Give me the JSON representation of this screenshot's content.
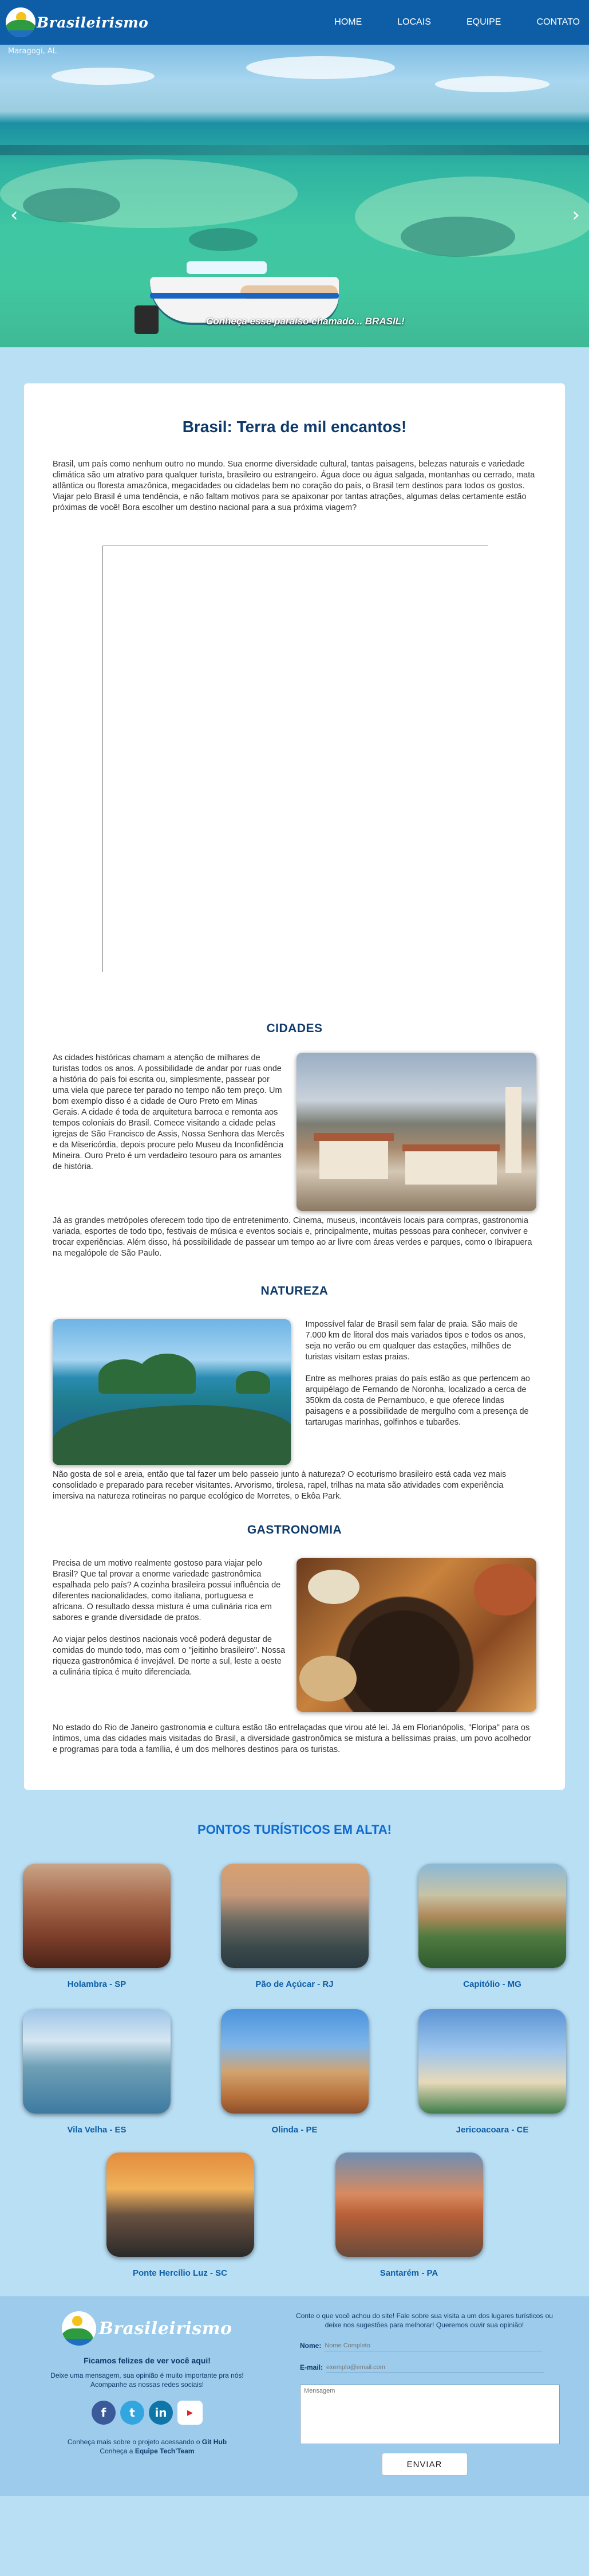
{
  "nav": {
    "brand": "Brasileirismo",
    "links": [
      "HOME",
      "LOCAIS",
      "EQUIPE",
      "CONTATO"
    ]
  },
  "hero": {
    "location": "Maragogi, AL",
    "caption": "Conheça esse paraíso chamado... BRASIL!",
    "prev": "‹",
    "next": "›"
  },
  "main": {
    "title": "Brasil: Terra de mil encantos!",
    "intro": "Brasil, um país como nenhum outro no mundo. Sua enorme diversidade cultural, tantas paisagens, belezas naturais e variedade climática são um atrativo para qualquer turista, brasileiro ou estrangeiro. Água doce ou água salgada, montanhas ou cerrado, mata atlântica ou floresta amazônica, megacidades ou cidadelas bem no coração do país, o Brasil tem destinos para todos os gostos. Viajar pelo Brasil é uma tendência, e não faltam motivos para se apaixonar por tantas atrações, algumas delas certamente estão próximas de você! Bora escolher um destino nacional para a sua próxima viagem?"
  },
  "cidades": {
    "title": "CIDADES",
    "p1": "As cidades históricas chamam a atenção de milhares de turistas todos os anos. A possibilidade de andar por ruas onde a história do país foi escrita ou, simplesmente, passear por uma viela que parece ter parado no tempo não tem preço. Um bom exemplo disso é a cidade de Ouro Preto em Minas Gerais. A cidade é toda de arquitetura barroca e remonta aos tempos coloniais do Brasil. Comece visitando a cidade pelas igrejas de São Francisco de Assis, Nossa Senhora das Mercês e da Misericórdia, depois procure pelo Museu da Inconfidência Mineira. Ouro Preto é um verdadeiro tesouro para os amantes de história.",
    "p2": "Já as grandes metrópoles oferecem todo tipo de entretenimento. Cinema, museus, incontáveis locais para compras, gastronomia variada, esportes de todo tipo, festivais de música e eventos sociais e, principalmente, muitas pessoas para conhecer, conviver e trocar experiências. Além disso, há possibilidade de passear um tempo ao ar livre com áreas verdes e parques, como o Ibirapuera na megalópole de São Paulo."
  },
  "natureza": {
    "title": "NATUREZA",
    "p1": "Impossível falar de Brasil sem falar de praia. São mais de 7.000 km de litoral dos mais variados tipos e todos os anos, seja no verão ou em qualquer das estações, milhões de turistas visitam estas praias.",
    "p2": "Entre as melhores praias do país estão as que pertencem ao arquipélago de Fernando de Noronha, localizado a cerca de 350km da costa de Pernambuco, e que oferece lindas paisagens e a possibilidade de mergulho com a presença de tartarugas marinhas, golfinhos e tubarões.",
    "p3": "Não gosta de sol e areia, então que tal fazer um belo passeio junto à natureza? O ecoturismo brasileiro está cada vez mais consolidado e preparado para receber visitantes. Arvorismo, tirolesa, rapel, trilhas na mata são atividades com experiência imersiva na natureza rotineiras no parque ecológico de Morretes, o Ekôa Park."
  },
  "gastronomia": {
    "title": "GASTRONOMIA",
    "p1": "Precisa de um motivo realmente gostoso para viajar pelo Brasil? Que tal provar a enorme variedade gastronômica espalhada pelo país? A cozinha brasileira possui influência de diferentes nacionalidades, como italiana, portuguesa e africana. O resultado dessa mistura é uma culinária rica em sabores e grande diversidade de pratos.",
    "p2": "Ao viajar pelos destinos nacionais você poderá degustar de comidas do mundo todo, mas com o \"jeitinho brasileiro\". Nossa riqueza gastronômica é invejável. De norte a sul, leste a oeste a culinária típica é muito diferenciada.",
    "p3": "No estado do Rio de Janeiro gastronomia e cultura estão tão entrelaçadas que virou até lei. Já em Florianópolis, \"Floripa\" para os íntimos, uma das cidades mais visitadas do Brasil, a diversidade gastronômica se mistura a belíssimas praias, um povo acolhedor e programas para toda a família, é um dos melhores destinos para os turistas."
  },
  "spots": {
    "title": "PONTOS TURÍSTICOS EM ALTA!",
    "items": [
      "Holambra - SP",
      "Pão de Açúcar - RJ",
      "Capitólio - MG",
      "Vila Velha - ES",
      "Olinda - PE",
      "Jericoacoara - CE",
      "Ponte Hercílio Luz - SC",
      "Santarém - PA"
    ]
  },
  "footer": {
    "brand": "Brasileirismo",
    "thanks": "Ficamos felizes de ver você aqui!",
    "leave_msg": "Deixe uma mensagem, sua opinião é muito importante pra nós!",
    "follow": "Acompanhe as nossas redes sociais!",
    "github_prefix": "Conheça mais sobre o projeto acessando o ",
    "github_link": "Git Hub",
    "team_prefix": "Conheça a ",
    "team_link": "Equipe Tech'Team",
    "prompt": "Conte o que você achou do site! Fale sobre sua visita a um dos lugares turísticos ou deixe nos sugestões para melhorar! Queremos ouvir sua opinião!",
    "name_label": "Nome:",
    "name_placeholder": "Nome Completo",
    "email_label": "E-mail:",
    "email_placeholder": "exemplo@email.com",
    "msg_placeholder": "Mensagem",
    "send": "ENVIAR"
  },
  "colors": {
    "navbar": "#0d5ea7",
    "page_bg": "#b9dff5",
    "title": "#0e3a6b",
    "accent": "#0d6bd1"
  }
}
